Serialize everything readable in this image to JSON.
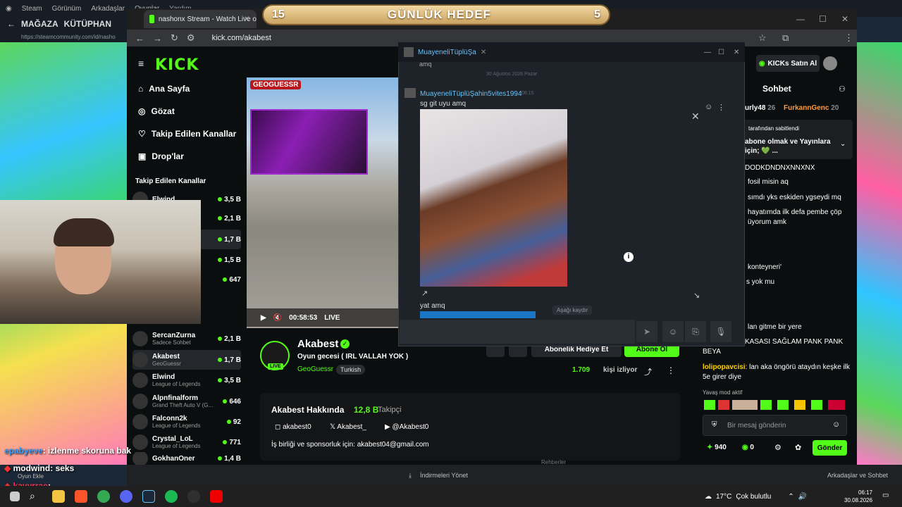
{
  "steam_menu": {
    "items": [
      "Steam",
      "Görünüm",
      "Arkadaşlar",
      "Oyunlar",
      "Yardım"
    ]
  },
  "steam_nav": {
    "store": "MAĞAZA",
    "library": "KÜTÜPHAN",
    "url": "https://steamcommunity.com/id/nasho"
  },
  "daily_goal": {
    "title": "GÜNLÜK HEDEF",
    "left": "15",
    "right": "5"
  },
  "browser": {
    "tab_title": "nashonx Stream - Watch Live o",
    "url": "kick.com/akabest"
  },
  "kick": {
    "logo": "KICK",
    "nav": [
      "Ana Sayfa",
      "Gözat",
      "Takip Edilen Kanallar",
      "Drop'lar"
    ],
    "followed_header": "Takip Edilen Kanallar",
    "top_channels": [
      {
        "name": "Elwind",
        "viewers": "3,5 B"
      },
      {
        "name": "",
        "viewers": "2,1 B"
      },
      {
        "name": "",
        "viewers": "1,7 B"
      },
      {
        "name": "",
        "viewers": "1,5 B"
      },
      {
        "name": "",
        "viewers": "647"
      }
    ],
    "channels": [
      {
        "name": "SercanZurna",
        "cat": "Sadece Sohbet",
        "viewers": "2,1 B"
      },
      {
        "name": "Akabest",
        "cat": "GeoGuessr",
        "viewers": "1,7 B"
      },
      {
        "name": "Elwind",
        "cat": "League of Legends",
        "viewers": "3,5 B"
      },
      {
        "name": "Alpnfinalform",
        "cat": "Grand Theft Auto V (G...",
        "viewers": "646"
      },
      {
        "name": "Falconn2k",
        "cat": "League of Legends",
        "viewers": "92"
      },
      {
        "name": "Crystal_LoL",
        "cat": "League of Legends",
        "viewers": "771"
      },
      {
        "name": "GokhanOner",
        "cat": "",
        "viewers": "1,4 B"
      }
    ],
    "kicks_button": "KICKs Satın Al",
    "chat_header": "Sohbet"
  },
  "player": {
    "time": "00:58:53",
    "live": "LIVE",
    "geo": "GEOGUESSR"
  },
  "stream": {
    "name": "Akabest",
    "title": "Oyun gecesi ( IRL VALLAH YOK )",
    "category": "GeoGuessr",
    "language": "Turkish",
    "viewers": "1.709",
    "viewers_label": "kişi izliyor",
    "sub_button": "Abonelik Hediye Et",
    "follow_button": "Abone Ol",
    "live_tag": "LIVE"
  },
  "about": {
    "title": "Akabest Hakkında",
    "followers": "12,8 B",
    "followers_label": "Takipçi",
    "instagram": "akabest0",
    "x": "Akabest_",
    "youtube": "@Akabest0",
    "mail": "İş birliği ve sponsorluk için: akabest04@gmail.com"
  },
  "chat": {
    "top_users": [
      {
        "name": "urly48",
        "count": "26"
      },
      {
        "name": "FurkannGenc",
        "count": "20"
      }
    ],
    "pinned_by": "tarafından sabitlendi",
    "pinned_text": "abone olmak ve Yayınlara için; 💚 ...",
    "lines": [
      {
        "u": "",
        "t": "DODKDNDNXNNXNX"
      },
      {
        "u": "",
        "t": "fosil misin aq"
      },
      {
        "u": "",
        "t": "sımdı yks eskiden ygseydi mq"
      },
      {
        "u": "",
        "t": "hayatımda ilk defa pembe çöp üyorum amk"
      },
      {
        "u": "",
        "t": "konteyneri'"
      },
      {
        "u": "",
        "t": "s yok mu"
      },
      {
        "u": "",
        "t": "lan gitme bir yere"
      },
      {
        "u": "",
        "t": "KASASI SAĞLAM PANK PANK BEYA"
      },
      {
        "u": "lolipopavcisi",
        "t": "lan aka öngörü ataydın keşke ilk 5e girer diye"
      }
    ],
    "slow_mode": "Yavaş mod aktif",
    "input_placeholder": "Bir mesaj gönderin",
    "kicks_count": "940",
    "other_count": "0",
    "send": "Gönder"
  },
  "steam_chat": {
    "title": "MuayeneliTüplüŞa",
    "prev": "amq",
    "date": "30 Ağustos 2026 Pazar",
    "sender": "MuayeneliTüplüŞahin5vites1994",
    "time": "06:15",
    "msg1": "sg git uyu amq",
    "msg2": "yat amq",
    "scroll_btn": "Aşağı kaydır"
  },
  "overlay_chat": [
    {
      "user": "epabyeve",
      "text": ": izlenme skoruna bak"
    },
    {
      "user": "modwind",
      "text": ": seks"
    },
    {
      "user": "kayyrrae",
      "text": ":"
    }
  ],
  "overlay_misc": {
    "add_game": "Oyun Ekle"
  },
  "downloads": {
    "manage": "İndirmeleri Yönet",
    "friends": "Arkadaşlar ve Sohbet",
    "mid": "Rehberler"
  },
  "taskbar": {
    "weather": "17°C",
    "weather_text": "Çok bulutlu",
    "time": "06:17",
    "date": "30.08.2026"
  },
  "colors": {
    "kick_green": "#53fc18",
    "steam_blue": "#67c1f5"
  }
}
